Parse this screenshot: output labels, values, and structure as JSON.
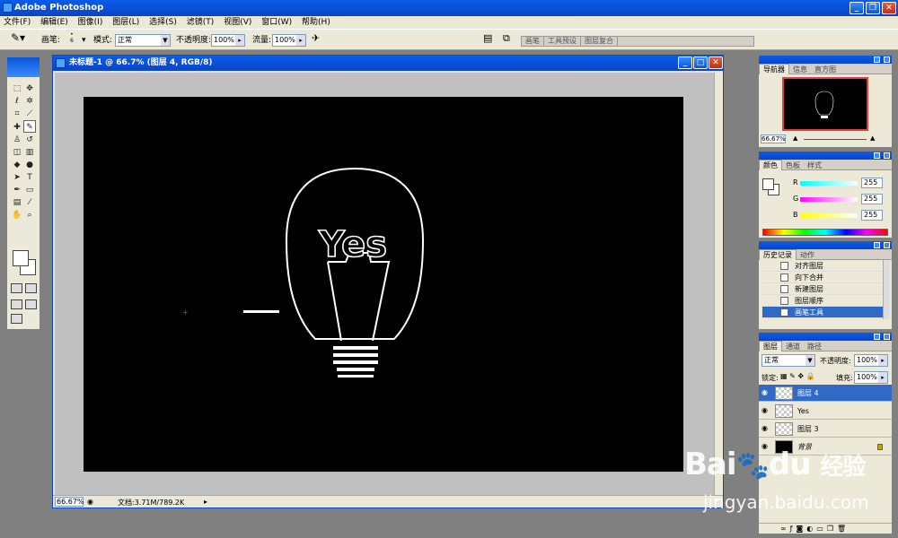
{
  "app": {
    "title": "Adobe Photoshop"
  },
  "menu": [
    "文件(F)",
    "编辑(E)",
    "图像(I)",
    "图层(L)",
    "选择(S)",
    "滤镜(T)",
    "视图(V)",
    "窗口(W)",
    "帮助(H)"
  ],
  "options": {
    "brush_label": "画笔:",
    "brush_size": "6",
    "mode_label": "模式:",
    "mode_value": "正常",
    "opacity_label": "不透明度:",
    "opacity_value": "100%",
    "flow_label": "流量:",
    "flow_value": "100%",
    "palette_tabs": [
      "画笔",
      "工具预设",
      "图层复合"
    ]
  },
  "document": {
    "title": "未标题-1 @ 66.7% (图层 4, RGB/8)",
    "zoom": "66.67%",
    "doc_size": "文档:3.71M/789.2K"
  },
  "canvas": {
    "text": "Yes"
  },
  "navigator": {
    "tabs": [
      "导航器",
      "信息",
      "直方图"
    ],
    "zoom": "66.67%"
  },
  "color": {
    "tabs": [
      "颜色",
      "色板",
      "样式"
    ],
    "channels": [
      {
        "label": "R",
        "value": "255",
        "grad": "#00e0e0"
      },
      {
        "label": "G",
        "value": "255",
        "grad": "#e000e0"
      },
      {
        "label": "B",
        "value": "255",
        "grad": "#e0e000"
      }
    ]
  },
  "history": {
    "tabs": [
      "历史记录",
      "动作"
    ],
    "items": [
      "对齐图层",
      "向下合并",
      "新建图层",
      "图层顺序",
      "画笔工具"
    ],
    "selected": 4
  },
  "layers": {
    "tabs": [
      "图层",
      "通道",
      "路径"
    ],
    "blend_mode": "正常",
    "opacity_label": "不透明度:",
    "opacity": "100%",
    "lock_label": "锁定:",
    "fill_label": "填充:",
    "fill": "100%",
    "items": [
      "图层 4",
      "Yes",
      "图层 3",
      "背景"
    ],
    "selected": 0
  },
  "watermark": {
    "brand_latin": "Bai",
    "brand_mid": "du",
    "brand_cn": "经验",
    "url": "jingyan.baidu.com"
  },
  "colors": {
    "title_blue": "#0a44c8",
    "panel_bg": "#ece9d8",
    "selection": "#316ac5"
  }
}
